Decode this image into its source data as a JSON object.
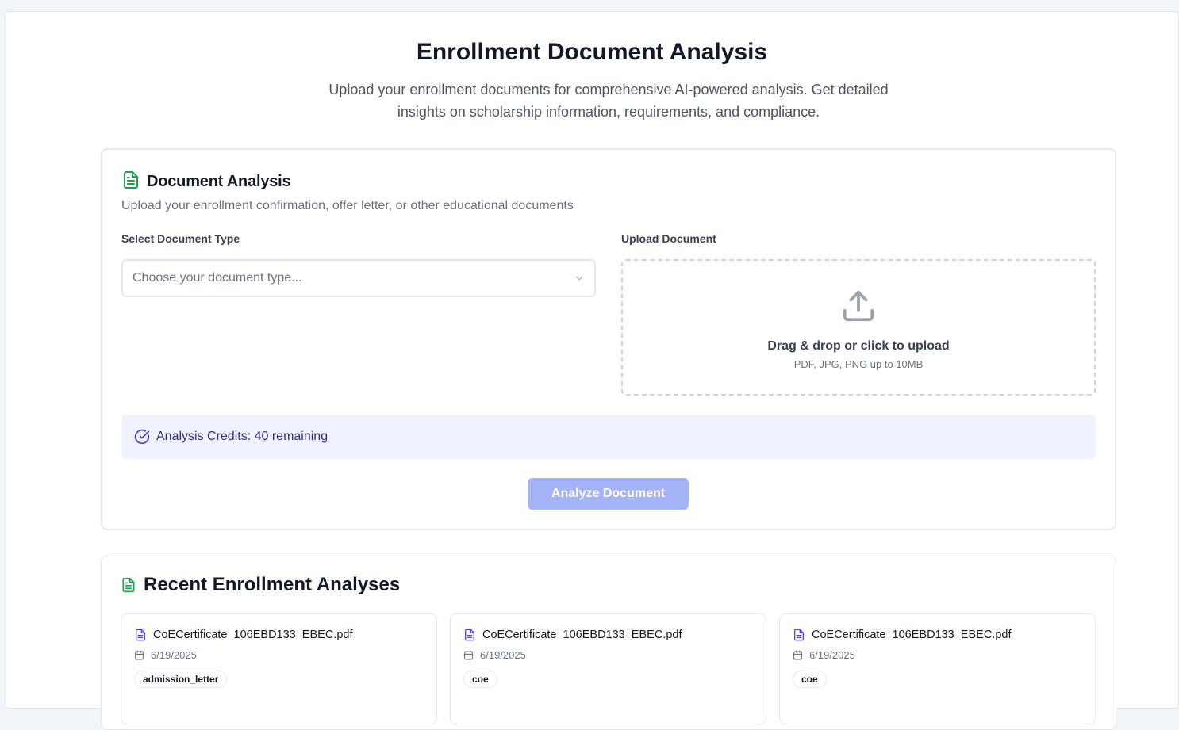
{
  "header": {
    "title": "Enrollment Document Analysis",
    "subtitle": "Upload your enrollment documents for comprehensive AI-powered analysis. Get detailed insights on scholarship information, requirements, and compliance."
  },
  "analysis_card": {
    "title": "Document Analysis",
    "description": "Upload your enrollment confirmation, offer letter, or other educational documents",
    "select_label": "Select Document Type",
    "select_placeholder": "Choose your document type...",
    "upload_label": "Upload Document",
    "upload_title": "Drag & drop or click to upload",
    "upload_hint": "PDF, JPG, PNG up to 10MB",
    "credits_text": "Analysis Credits: 40 remaining",
    "analyze_button": "Analyze Document"
  },
  "recent": {
    "title": "Recent Enrollment Analyses",
    "items": [
      {
        "filename": "CoECertificate_106EBD133_EBEC.pdf",
        "date": "6/19/2025",
        "tag": "admission_letter"
      },
      {
        "filename": "CoECertificate_106EBD133_EBEC.pdf",
        "date": "6/19/2025",
        "tag": "coe"
      },
      {
        "filename": "CoECertificate_106EBD133_EBEC.pdf",
        "date": "6/19/2025",
        "tag": "coe"
      }
    ]
  },
  "colors": {
    "accent_green": "#16a34a",
    "accent_indigo": "#4f46e5",
    "button_disabled": "#a5b4f8",
    "credits_bg": "#eef3fe"
  }
}
